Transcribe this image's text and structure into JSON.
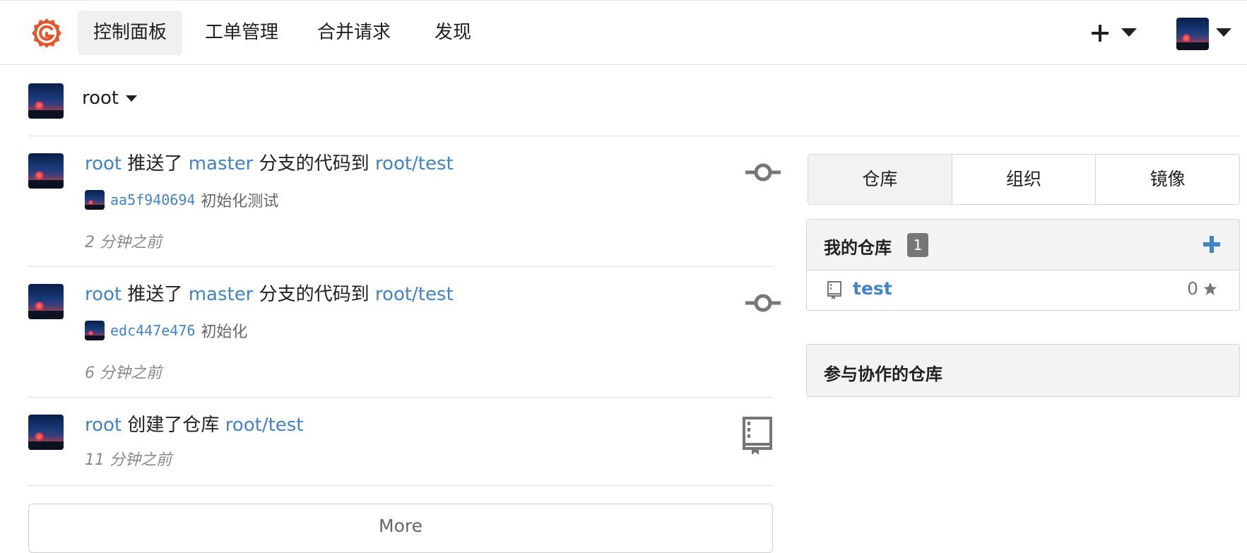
{
  "brand": {
    "color": "#e4572e",
    "icon": "gitea-logo-icon"
  },
  "nav": {
    "items": [
      {
        "label": "控制面板",
        "active": true
      },
      {
        "label": "工单管理",
        "active": false
      },
      {
        "label": "合并请求",
        "active": false
      },
      {
        "label": "发现",
        "active": false
      }
    ],
    "create_icon": "plus-icon",
    "avatar_icon": "user-avatar"
  },
  "context": {
    "user": "root"
  },
  "feed": [
    {
      "user": "root",
      "action_1": "推送了",
      "branch": "master",
      "action_2": "分支的代码到",
      "repo": "root/test",
      "commit": {
        "sha": "aa5f940694",
        "message": "初始化测试"
      },
      "time": "2 分钟之前",
      "icon": "git-commit-icon"
    },
    {
      "user": "root",
      "action_1": "推送了",
      "branch": "master",
      "action_2": "分支的代码到",
      "repo": "root/test",
      "commit": {
        "sha": "edc447e476",
        "message": "初始化"
      },
      "time": "6 分钟之前",
      "icon": "git-commit-icon"
    },
    {
      "user": "root",
      "action_1": "创建了仓库",
      "repo": "root/test",
      "time": "11 分钟之前",
      "icon": "repo-book-icon"
    }
  ],
  "more_label": "More",
  "sidebar": {
    "tabs": [
      {
        "label": "仓库",
        "active": true
      },
      {
        "label": "组织",
        "active": false
      },
      {
        "label": "镜像",
        "active": false
      }
    ],
    "my_repos": {
      "title": "我的仓库",
      "count": "1",
      "add_icon": "plus-icon",
      "items": [
        {
          "name": "test",
          "stars": "0"
        }
      ]
    },
    "collab_repos": {
      "title": "参与协作的仓库"
    }
  },
  "colors": {
    "link": "#4183c4",
    "muted": "#888888",
    "badge": "#767676",
    "header_bg": "#f3f3f3"
  }
}
